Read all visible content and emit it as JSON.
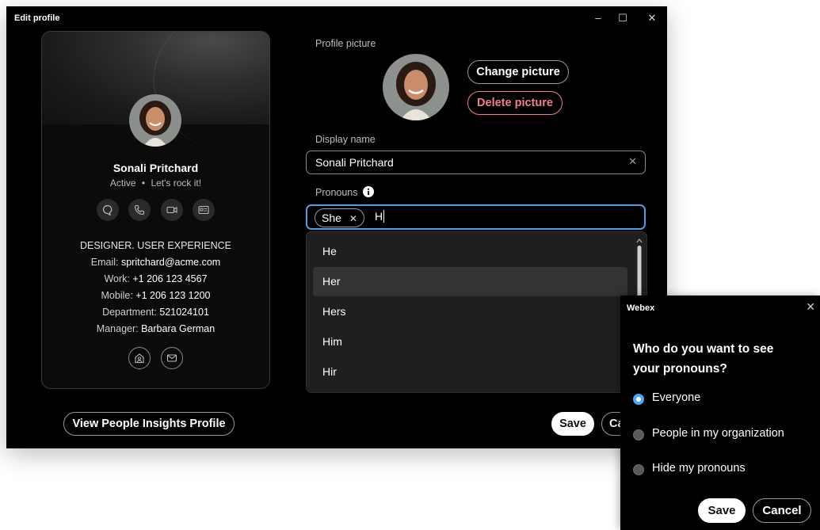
{
  "window": {
    "title": "Edit profile",
    "controls": {
      "minimize": "–",
      "maximize": "☐",
      "close": "✕"
    }
  },
  "card": {
    "name": "Sonali Pritchard",
    "status": "Active",
    "status_separator": "•",
    "status_message": "Let's rock it!",
    "actions": [
      "chat-icon",
      "phone-icon",
      "video-icon",
      "contact-card-icon"
    ],
    "job_title": "DESIGNER. USER EXPERIENCE",
    "details": [
      {
        "label": "Email:",
        "value": "spritchard@acme.com"
      },
      {
        "label": "Work:",
        "value": "+1 206 123 4567"
      },
      {
        "label": "Mobile:",
        "value": "+1 206 123 1200"
      },
      {
        "label": "Department:",
        "value": "521024101"
      },
      {
        "label": "Manager:",
        "value": "Barbara German"
      }
    ],
    "bottom_actions": [
      "directory-icon",
      "mail-icon"
    ]
  },
  "footer": {
    "insights_label": "View People Insights Profile",
    "save_label": "Save",
    "cancel_label": "Ca"
  },
  "form": {
    "picture_label": "Profile picture",
    "change_picture": "Change picture",
    "delete_picture": "Delete picture",
    "display_name_label": "Display name",
    "display_name_value": "Sonali Pritchard",
    "pronouns_label": "Pronouns",
    "pronoun_chip": "She",
    "pronoun_chip_remove": "✕",
    "pronoun_typed": "H",
    "suggestions": [
      "He",
      "Her",
      "Hers",
      "Him",
      "Hir"
    ],
    "hovered_suggestion": "Her"
  },
  "popup": {
    "app_name": "Webex",
    "close": "✕",
    "question_line1": "Who do you want to see",
    "question_line2": "your pronouns?",
    "options": [
      "Everyone",
      "People in my organization",
      "Hide my pronouns"
    ],
    "selected": "Everyone",
    "save_label": "Save",
    "cancel_label": "Cancel"
  },
  "colors": {
    "accent_blue": "#4a9fe8",
    "danger_red": "#f07f86",
    "window_bg": "#000000",
    "dropdown_bg": "#1f1f1f"
  }
}
